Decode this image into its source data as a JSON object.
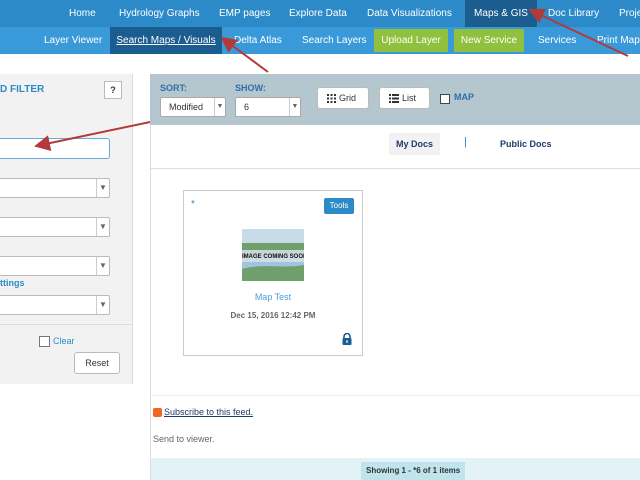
{
  "top_nav": {
    "items": [
      {
        "label": "Home"
      },
      {
        "label": "Hydrology Graphs"
      },
      {
        "label": "EMP pages"
      },
      {
        "label": "Explore Data"
      },
      {
        "label": "Data Visualizations"
      },
      {
        "label": "Maps & GIS",
        "active": true
      },
      {
        "label": "Doc Library"
      },
      {
        "label": "Proje"
      }
    ]
  },
  "sub_nav": {
    "items": [
      {
        "label": "Layer Viewer"
      },
      {
        "label": "Search Maps / Visuals",
        "active": true
      },
      {
        "label": "Delta Atlas"
      },
      {
        "label": "Search Layers"
      },
      {
        "label": "Upload Layer",
        "green": true
      },
      {
        "label": "New Service",
        "green": true
      },
      {
        "label": "Services"
      },
      {
        "label": "Print Map"
      }
    ]
  },
  "filter_panel": {
    "title": "D FILTER",
    "help_label": "?",
    "settings_label": "ttings",
    "clear_label": "Clear",
    "reset_label": "Reset"
  },
  "toolbar": {
    "sort_label": "SORT:",
    "sort_value": "Modified",
    "show_label": "SHOW:",
    "show_value": "6",
    "grid_label": "Grid",
    "list_label": "List",
    "map_label": "MAP"
  },
  "tabs": {
    "my_docs": "My Docs",
    "separator": "|",
    "public_docs": "Public Docs"
  },
  "card": {
    "star": "*",
    "tools_label": "Tools",
    "thumb_text": "IMAGE COMING SOON",
    "title": "Map Test",
    "date": "Dec 15, 2016 12:42 PM",
    "icon": "lock-icon"
  },
  "footer": {
    "subscribe_label": "Subscribe to this feed.",
    "send_to_viewer": "Send to viewer.",
    "showing": "Showing 1 - *6 of 1 items"
  },
  "colors": {
    "nav_blue": "#2d8ac9",
    "active_dark": "#1c5d8f",
    "green": "#8fc13e",
    "annotation_red": "#b33a3a"
  }
}
